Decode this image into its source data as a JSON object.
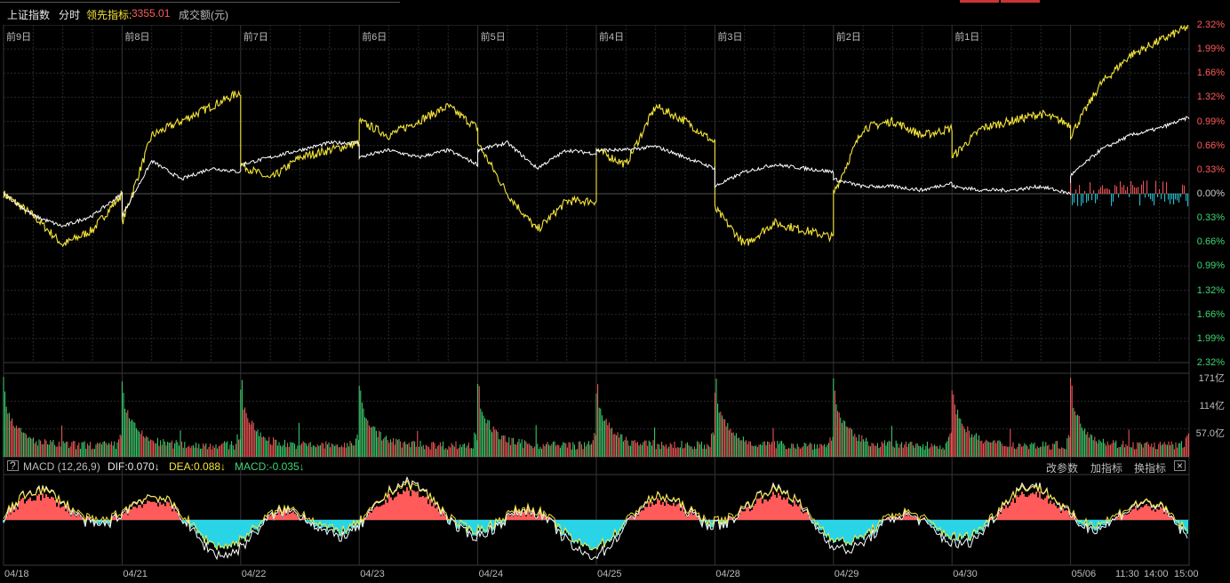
{
  "header": {
    "index_name": "上证指数",
    "mode": "分时",
    "leading_label": "领先指标:",
    "leading_value": "3355.01",
    "volume_label": "成交额(元)"
  },
  "colors": {
    "price_line": "#ffffff",
    "leading_line": "#f5e43a",
    "up": "#ff5b5b",
    "down": "#3fd673",
    "macd_down": "#28d4e6",
    "grid": "#2a2a2a",
    "accent_red": "#d33"
  },
  "day_labels": [
    "前9日",
    "前8日",
    "前7日",
    "前6日",
    "前5日",
    "前4日",
    "前3日",
    "前2日",
    "前1日"
  ],
  "price_axis": {
    "up_labels": [
      "2.32%",
      "1.99%",
      "1.66%",
      "1.32%",
      "0.99%",
      "0.66%",
      "0.33%"
    ],
    "zero_label": "0.00%",
    "down_labels": [
      "0.33%",
      "0.66%",
      "0.99%",
      "1.32%",
      "1.66%",
      "1.99%",
      "2.32%"
    ]
  },
  "volume_axis": [
    "171亿",
    "114亿",
    "57.0亿"
  ],
  "macd": {
    "help": "?",
    "name": "MACD (12,26,9)",
    "dif": "DIF:0.070↓",
    "dea": "DEA:0.088↓",
    "macd": "MACD:-0.035↓",
    "btn_params": "改参数",
    "btn_add": "加指标",
    "btn_switch": "换指标",
    "btn_close": "×"
  },
  "date_labels": [
    "04/18",
    "04/21",
    "04/22",
    "04/23",
    "04/24",
    "04/25",
    "04/28",
    "04/29",
    "04/30",
    "05/06"
  ],
  "time_labels": [
    "11:30",
    "14:00",
    "15:00"
  ]
}
